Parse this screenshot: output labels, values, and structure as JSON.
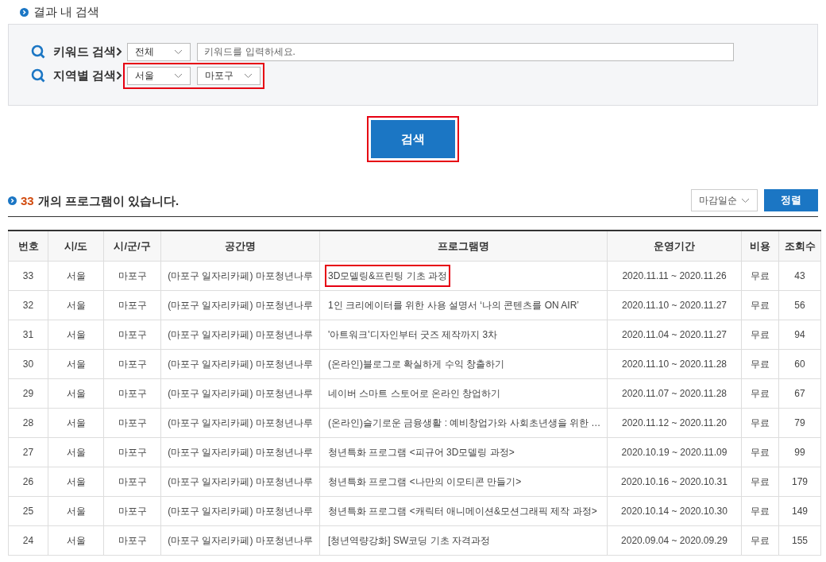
{
  "filter_section": {
    "title": "결과 내 검색",
    "rows": [
      {
        "label": "키워드 검색",
        "selects": [
          {
            "value": "전체"
          }
        ],
        "input": {
          "placeholder": "키워드를 입력하세요."
        },
        "highlighted": false
      },
      {
        "label": "지역별 검색",
        "selects": [
          {
            "value": "서울"
          },
          {
            "value": "마포구"
          }
        ],
        "highlighted": true
      }
    ],
    "search_button": {
      "label": "검색",
      "highlighted": true
    }
  },
  "results": {
    "count": "33",
    "count_text": "개의 프로그램이 있습니다.",
    "sort_select": "마감일순",
    "sort_button": "정렬"
  },
  "table": {
    "columns": [
      "번호",
      "시/도",
      "시/군/구",
      "공간명",
      "프로그램명",
      "운영기간",
      "비용",
      "조회수"
    ],
    "rows": [
      {
        "cells": [
          "33",
          "서울",
          "마포구",
          "(마포구 일자리카페) 마포청년나루",
          "3D모델링&프린팅 기초 과정",
          "2020.11.11 ~ 2020.11.26",
          "무료",
          "43"
        ],
        "highlighted": true
      },
      {
        "cells": [
          "32",
          "서울",
          "마포구",
          "(마포구 일자리카페) 마포청년나루",
          "1인 크리에이터를 위한 사용 설명서 ‘나의 콘텐츠를 ON AIR’",
          "2020.11.10 ~ 2020.11.27",
          "무료",
          "56"
        ],
        "highlighted": false
      },
      {
        "cells": [
          "31",
          "서울",
          "마포구",
          "(마포구 일자리카페) 마포청년나루",
          "'아트워크'디자인부터 굿즈 제작까지 3차",
          "2020.11.04 ~ 2020.11.27",
          "무료",
          "94"
        ],
        "highlighted": false
      },
      {
        "cells": [
          "30",
          "서울",
          "마포구",
          "(마포구 일자리카페) 마포청년나루",
          "(온라인)블로그로 확실하게 수익 창출하기",
          "2020.11.10 ~ 2020.11.28",
          "무료",
          "60"
        ],
        "highlighted": false
      },
      {
        "cells": [
          "29",
          "서울",
          "마포구",
          "(마포구 일자리카페) 마포청년나루",
          "네이버 스마트 스토어로 온라인 창업하기",
          "2020.11.07 ~ 2020.11.28",
          "무료",
          "67"
        ],
        "highlighted": false
      },
      {
        "cells": [
          "28",
          "서울",
          "마포구",
          "(마포구 일자리카페) 마포청년나루",
          "(온라인)슬기로운 금융생활 : 예비창업가와 사회초년생을 위한 …",
          "2020.11.12 ~ 2020.11.20",
          "무료",
          "79"
        ],
        "highlighted": false
      },
      {
        "cells": [
          "27",
          "서울",
          "마포구",
          "(마포구 일자리카페) 마포청년나루",
          "청년특화 프로그램 <피규어 3D모델링 과정>",
          "2020.10.19 ~ 2020.11.09",
          "무료",
          "99"
        ],
        "highlighted": false
      },
      {
        "cells": [
          "26",
          "서울",
          "마포구",
          "(마포구 일자리카페) 마포청년나루",
          "청년특화 프로그램 <나만의 이모티콘 만들기>",
          "2020.10.16 ~ 2020.10.31",
          "무료",
          "179"
        ],
        "highlighted": false
      },
      {
        "cells": [
          "25",
          "서울",
          "마포구",
          "(마포구 일자리카페) 마포청년나루",
          "청년특화 프로그램 <캐릭터 애니메이션&모션그래픽 제작 과정>",
          "2020.10.14 ~ 2020.10.30",
          "무료",
          "149"
        ],
        "highlighted": false
      },
      {
        "cells": [
          "24",
          "서울",
          "마포구",
          "(마포구 일자리카페) 마포청년나루",
          "[청년역량강화] SW코딩 기초 자격과정",
          "2020.09.04 ~ 2020.09.29",
          "무료",
          "155"
        ],
        "highlighted": false
      }
    ]
  }
}
